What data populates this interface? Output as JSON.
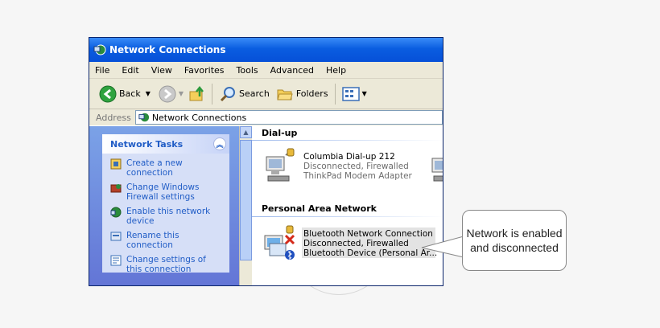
{
  "window": {
    "title": "Network Connections"
  },
  "menu": [
    "File",
    "Edit",
    "View",
    "Favorites",
    "Tools",
    "Advanced",
    "Help"
  ],
  "toolbar": {
    "back_label": "Back",
    "search_label": "Search",
    "folders_label": "Folders"
  },
  "address": {
    "label": "Address",
    "value": "Network Connections"
  },
  "tasks": {
    "header": "Network Tasks",
    "items": [
      {
        "label": "Create a new connection",
        "icon": "new-connection-icon"
      },
      {
        "label": "Change Windows Firewall settings",
        "icon": "firewall-icon"
      },
      {
        "label": "Enable this network device",
        "icon": "enable-device-icon"
      },
      {
        "label": "Rename this connection",
        "icon": "rename-icon"
      },
      {
        "label": "Change settings of this connection",
        "icon": "settings-icon"
      }
    ]
  },
  "groups": {
    "dialup": {
      "title": "Dial-up",
      "item": {
        "name": "Columbia Dial-up 212",
        "status": "Disconnected, Firewalled",
        "device": "ThinkPad Modem Adapter"
      }
    },
    "pan": {
      "title": "Personal Area Network",
      "item": {
        "name": "Bluetooth Network Connection",
        "status": "Disconnected, Firewalled",
        "device": "Bluetooth Device (Personal Ar..."
      }
    }
  },
  "callout": {
    "text": "Network is enabled and disconnected"
  },
  "colors": {
    "titlebar": "#0a5de0",
    "task_link": "#215dc6",
    "task_panel": "#d6dff7"
  }
}
